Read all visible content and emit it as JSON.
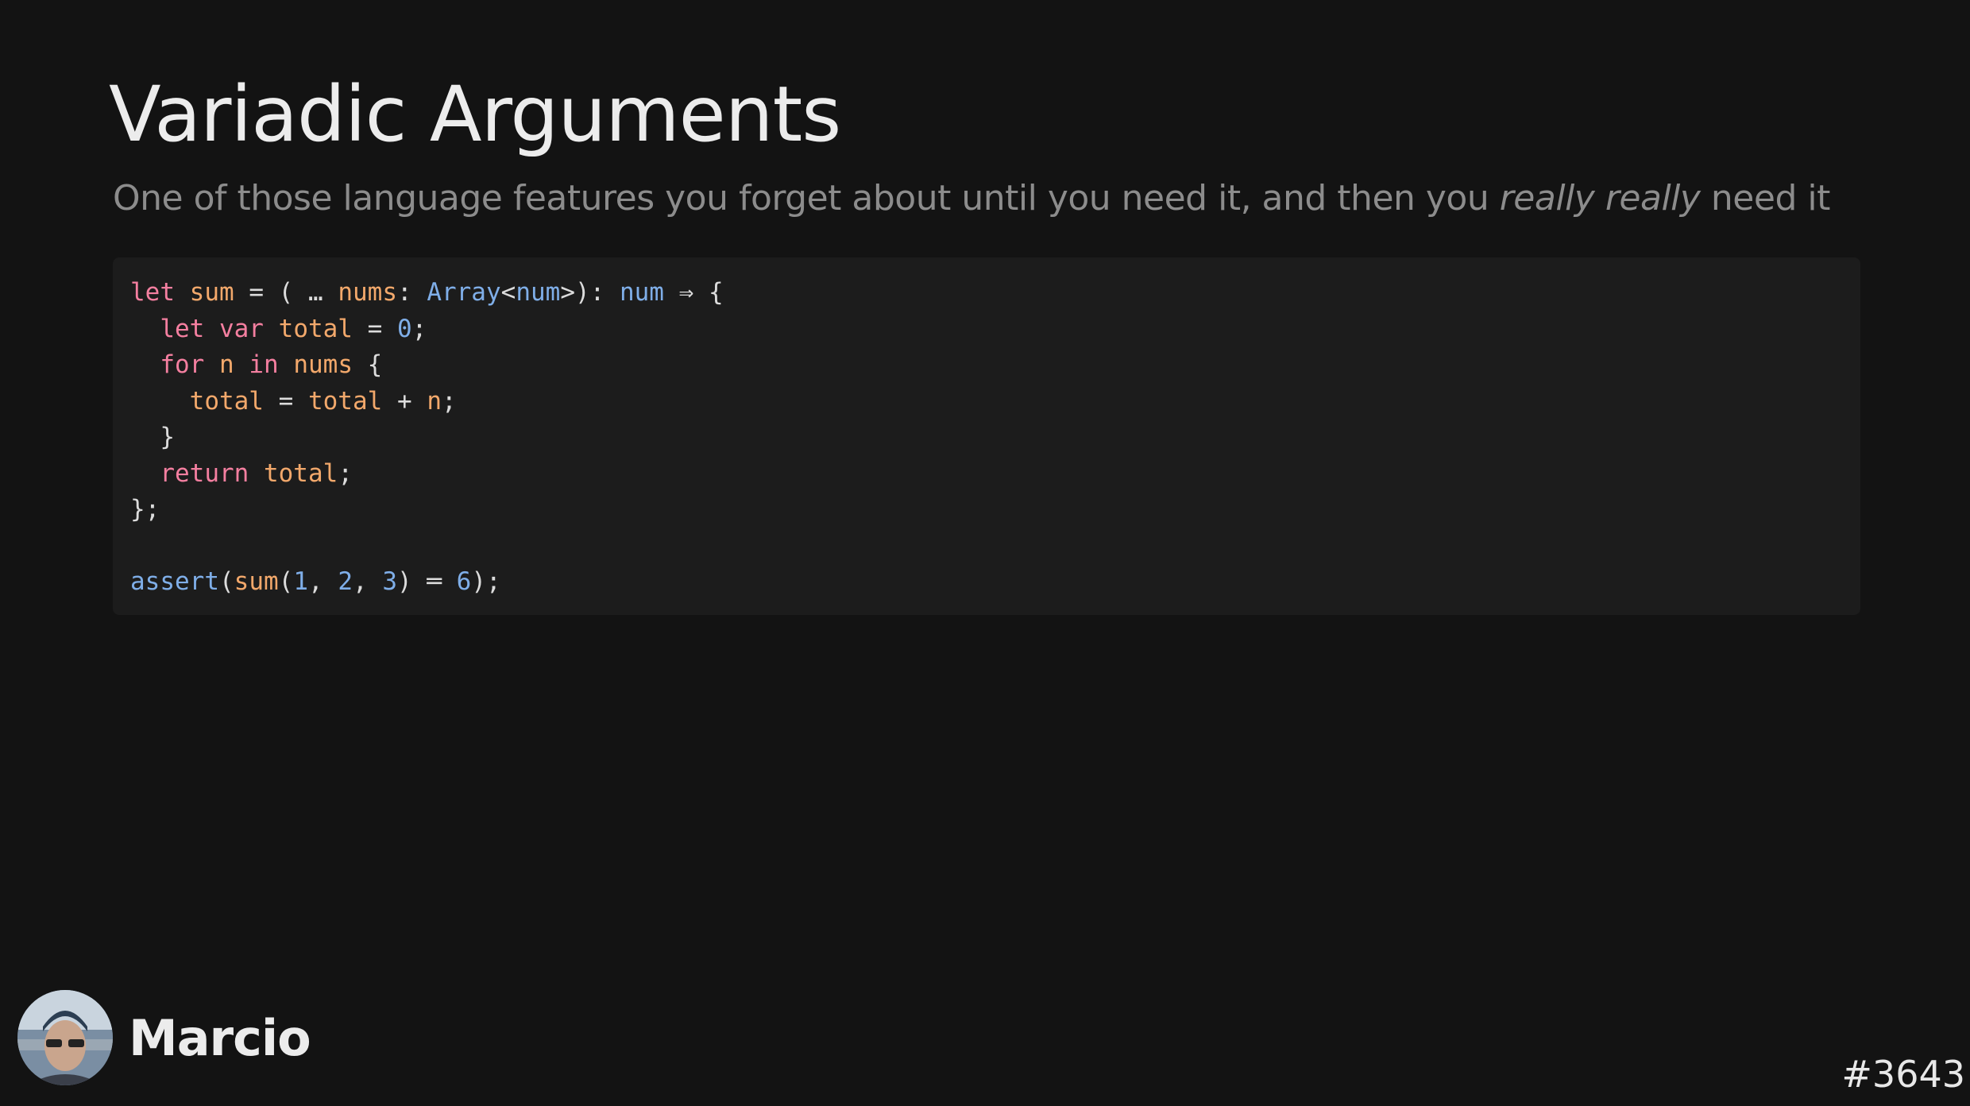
{
  "slide": {
    "title": "Variadic Arguments",
    "subtitle_before": "One of those language features you forget about until you need it, and then you ",
    "subtitle_emphasis": "really really",
    "subtitle_after": " need it",
    "number": "#3643"
  },
  "presenter": {
    "name": "Marcio",
    "avatar_icon": "presenter-photo"
  },
  "code": {
    "lines": [
      [
        [
          "kw",
          "let"
        ],
        [
          "pu",
          " "
        ],
        [
          "id",
          "sum"
        ],
        [
          "pu",
          " = ( … "
        ],
        [
          "id",
          "nums"
        ],
        [
          "pu",
          ": "
        ],
        [
          "ty",
          "Array"
        ],
        [
          "pu",
          "<"
        ],
        [
          "ty",
          "num"
        ],
        [
          "pu",
          ">): "
        ],
        [
          "ty",
          "num"
        ],
        [
          "pu",
          " ⇒ {"
        ]
      ],
      [
        [
          "pu",
          "  "
        ],
        [
          "kw",
          "let var"
        ],
        [
          "pu",
          " "
        ],
        [
          "id",
          "total"
        ],
        [
          "pu",
          " = "
        ],
        [
          "num",
          "0"
        ],
        [
          "pu",
          ";"
        ]
      ],
      [
        [
          "pu",
          "  "
        ],
        [
          "kw",
          "for"
        ],
        [
          "pu",
          " "
        ],
        [
          "id",
          "n"
        ],
        [
          "pu",
          " "
        ],
        [
          "kw",
          "in"
        ],
        [
          "pu",
          " "
        ],
        [
          "id",
          "nums"
        ],
        [
          "pu",
          " {"
        ]
      ],
      [
        [
          "pu",
          "    "
        ],
        [
          "id",
          "total"
        ],
        [
          "pu",
          " = "
        ],
        [
          "id",
          "total"
        ],
        [
          "pu",
          " + "
        ],
        [
          "id",
          "n"
        ],
        [
          "pu",
          ";"
        ]
      ],
      [
        [
          "pu",
          "  }"
        ]
      ],
      [
        [
          "pu",
          "  "
        ],
        [
          "kw",
          "return"
        ],
        [
          "pu",
          " "
        ],
        [
          "id",
          "total"
        ],
        [
          "pu",
          ";"
        ]
      ],
      [
        [
          "pu",
          "};"
        ]
      ],
      [
        [
          "pu",
          ""
        ]
      ],
      [
        [
          "fn",
          "assert"
        ],
        [
          "pu",
          "("
        ],
        [
          "id",
          "sum"
        ],
        [
          "pu",
          "("
        ],
        [
          "num",
          "1"
        ],
        [
          "pu",
          ", "
        ],
        [
          "num",
          "2"
        ],
        [
          "pu",
          ", "
        ],
        [
          "num",
          "3"
        ],
        [
          "pu",
          ") ═ "
        ],
        [
          "num",
          "6"
        ],
        [
          "pu",
          ");"
        ]
      ]
    ]
  },
  "colors": {
    "background": "#131313",
    "code_background": "#1c1c1c",
    "keyword": "#f47fa0",
    "identifier": "#f2a86b",
    "type": "#7faee8"
  }
}
